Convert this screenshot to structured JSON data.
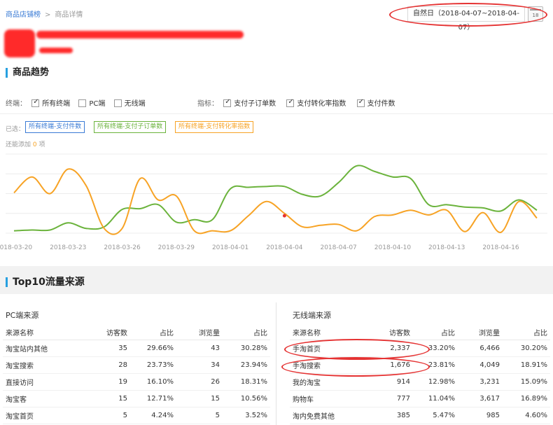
{
  "breadcrumb": {
    "link": "商品店铺榜",
    "separator": ">",
    "current": "商品详情"
  },
  "date_range": {
    "label": "自然日（2018-04-07~2018-04-07）",
    "calendar_text": "18"
  },
  "trend_section": {
    "title": "商品趋势",
    "terminal_label": "终端：",
    "terminals": [
      {
        "label": "所有终端",
        "checked": true
      },
      {
        "label": "PC端",
        "checked": false
      },
      {
        "label": "无线端",
        "checked": false
      }
    ],
    "metric_label": "指标：",
    "metrics": [
      {
        "label": "支付子订单数",
        "checked": true
      },
      {
        "label": "支付转化率指数",
        "checked": true
      },
      {
        "label": "支付件数",
        "checked": true
      }
    ],
    "selected_label": "已选：",
    "selected_tags": [
      {
        "label": "所有终端-支付件数",
        "color": "#3a7bd5"
      },
      {
        "label": "所有终端-支付子订单数",
        "color": "#6bb33c"
      },
      {
        "label": "所有终端-支付转化率指数",
        "color": "#f7a325"
      }
    ],
    "add_more_prefix": "还能添加",
    "add_more_count": "0",
    "add_more_suffix": "项"
  },
  "chart_data": {
    "type": "line",
    "x": [
      "2018-03-20",
      "2018-03-21",
      "2018-03-22",
      "2018-03-23",
      "2018-03-24",
      "2018-03-25",
      "2018-03-26",
      "2018-03-27",
      "2018-03-28",
      "2018-03-29",
      "2018-03-30",
      "2018-03-31",
      "2018-04-01",
      "2018-04-02",
      "2018-04-03",
      "2018-04-04",
      "2018-04-05",
      "2018-04-06",
      "2018-04-07",
      "2018-04-08",
      "2018-04-09",
      "2018-04-10",
      "2018-04-11",
      "2018-04-12",
      "2018-04-13",
      "2018-04-14",
      "2018-04-15",
      "2018-04-16",
      "2018-04-17",
      "2018-04-18"
    ],
    "tick_labels": [
      "2018-03-20",
      "2018-03-23",
      "2018-03-26",
      "2018-03-29",
      "2018-04-01",
      "2018-04-04",
      "2018-04-07",
      "2018-04-10",
      "2018-04-13",
      "2018-04-16"
    ],
    "ylim": [
      0,
      100
    ],
    "grid": true,
    "series": [
      {
        "color": "#6bb33c",
        "values": [
          3,
          4,
          4,
          13,
          6,
          8,
          30,
          31,
          36,
          14,
          17,
          17,
          56,
          58,
          59,
          59,
          49,
          47,
          64,
          85,
          78,
          71,
          69,
          36,
          36,
          33,
          32,
          28,
          42,
          29
        ]
      },
      {
        "color": "#f7a325",
        "values": [
          51,
          71,
          50,
          81,
          60,
          6,
          6,
          69,
          42,
          47,
          3,
          3,
          3,
          22,
          40,
          25,
          8,
          10,
          11,
          3,
          21,
          23,
          29,
          23,
          29,
          2,
          26,
          1,
          40,
          19
        ]
      }
    ],
    "marker": {
      "x_index": 15,
      "value": 22,
      "color": "#e53333"
    }
  },
  "top10": {
    "title": "Top10流量来源",
    "pc": {
      "title": "PC端来源",
      "headers": [
        "来源名称",
        "访客数",
        "占比",
        "浏览量",
        "占比"
      ],
      "rows": [
        [
          "淘宝站内其他",
          "35",
          "29.66%",
          "43",
          "30.28%"
        ],
        [
          "淘宝搜索",
          "28",
          "23.73%",
          "34",
          "23.94%"
        ],
        [
          "直接访问",
          "19",
          "16.10%",
          "26",
          "18.31%"
        ],
        [
          "淘宝客",
          "15",
          "12.71%",
          "15",
          "10.56%"
        ],
        [
          "淘宝首页",
          "5",
          "4.24%",
          "5",
          "3.52%"
        ]
      ]
    },
    "mobile": {
      "title": "无线端来源",
      "headers": [
        "来源名称",
        "访客数",
        "占比",
        "浏览量",
        "占比"
      ],
      "rows": [
        [
          "手淘首页",
          "2,337",
          "33.20%",
          "6,466",
          "30.20%"
        ],
        [
          "手淘搜索",
          "1,676",
          "23.81%",
          "4,049",
          "18.91%"
        ],
        [
          "我的淘宝",
          "914",
          "12.98%",
          "3,231",
          "15.09%"
        ],
        [
          "购物车",
          "777",
          "11.04%",
          "3,617",
          "16.89%"
        ],
        [
          "淘内免费其他",
          "385",
          "5.47%",
          "985",
          "4.60%"
        ]
      ]
    }
  }
}
